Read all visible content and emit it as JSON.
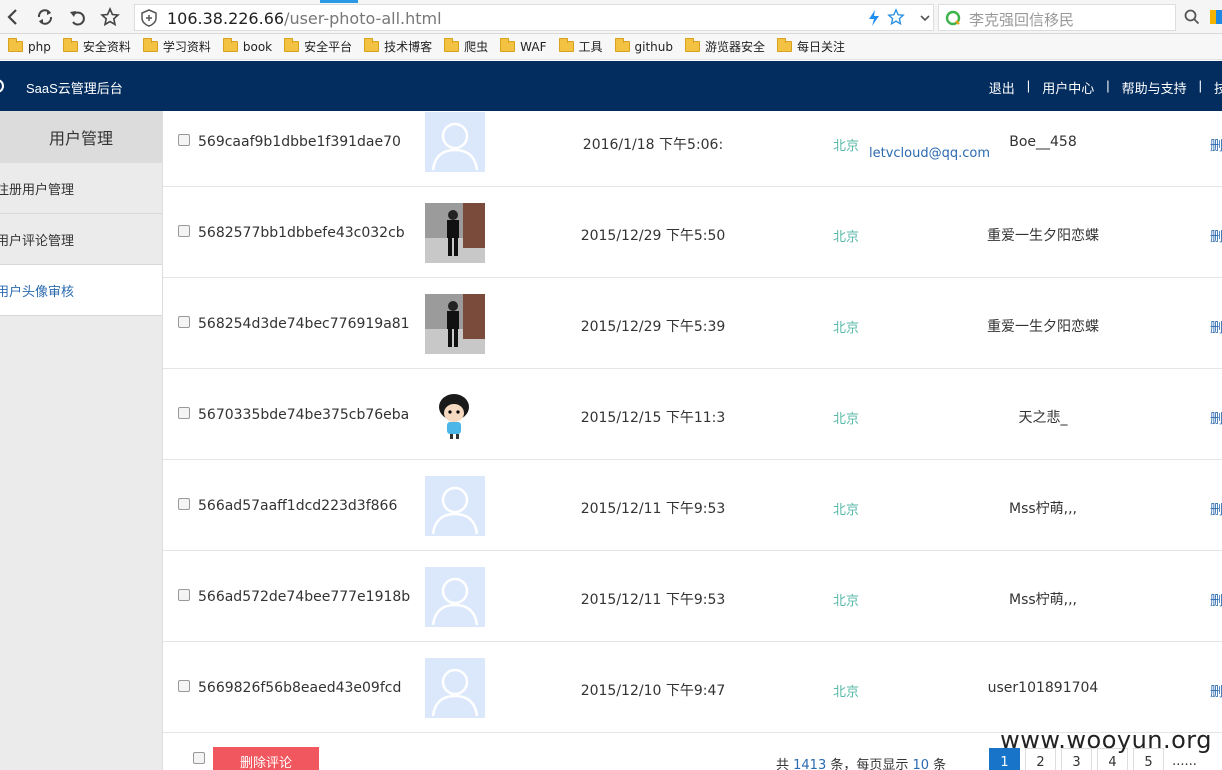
{
  "browser": {
    "url_host": "106.38.226.66",
    "url_path": "/user-photo-all.html",
    "search_placeholder": "李克强回信移民",
    "bookmarks": [
      "php",
      "安全资料",
      "学习资料",
      "book",
      "安全平台",
      "技术博客",
      "爬虫",
      "WAF",
      "工具",
      "github",
      "游览器安全",
      "每日关注"
    ]
  },
  "header": {
    "title": "SaaS云管理后台",
    "nav": [
      "退出",
      "用户中心",
      "帮助与支持",
      "技"
    ]
  },
  "sidebar": {
    "heading": "用户管理",
    "items": [
      {
        "label": "注册用户管理",
        "active": false
      },
      {
        "label": "用户评论管理",
        "active": false
      },
      {
        "label": "用户头像审核",
        "active": true
      }
    ]
  },
  "rows": [
    {
      "id": "569caaf9b1dbbe1f391dae70",
      "photo": "default",
      "date": "2016/1/18 下午5:06:",
      "city": "北京",
      "nick": "Boe__458",
      "email": "letvcloud@qq.com",
      "action": "删"
    },
    {
      "id": "5682577bb1dbbefe43c032cb",
      "photo": "person",
      "date": "2015/12/29 下午5:50",
      "city": "北京",
      "nick": "重爱一生夕阳恋蝶",
      "action": "删"
    },
    {
      "id": "568254d3de74bec776919a81",
      "photo": "person",
      "date": "2015/12/29 下午5:39",
      "city": "北京",
      "nick": "重爱一生夕阳恋蝶",
      "action": "删"
    },
    {
      "id": "5670335bde74be375cb76eba",
      "photo": "cartoon",
      "date": "2015/12/15 下午11:3",
      "city": "北京",
      "nick": "天之悲_",
      "action": "删"
    },
    {
      "id": "566ad57aaff1dcd223d3f866",
      "photo": "default",
      "date": "2015/12/11 下午9:53",
      "city": "北京",
      "nick": "Mss柠萌,,,",
      "action": "删"
    },
    {
      "id": "566ad572de74bee777e1918b",
      "photo": "default",
      "date": "2015/12/11 下午9:53",
      "city": "北京",
      "nick": "Mss柠萌,,,",
      "action": "删"
    },
    {
      "id": "5669826f56b8eaed43e09fcd",
      "photo": "default",
      "date": "2015/12/10 下午9:47",
      "city": "北京",
      "nick": "user101891704",
      "action": "删"
    }
  ],
  "footer": {
    "delete_label": "删除评论",
    "total_prefix": "共 ",
    "total": "1413",
    "total_mid": " 条，每页显示 ",
    "per_page": "10",
    "total_suffix": " 条",
    "pages": [
      "1",
      "2",
      "3",
      "4",
      "5",
      "......"
    ],
    "current_page": "1"
  },
  "watermark": "www.wooyun.org"
}
